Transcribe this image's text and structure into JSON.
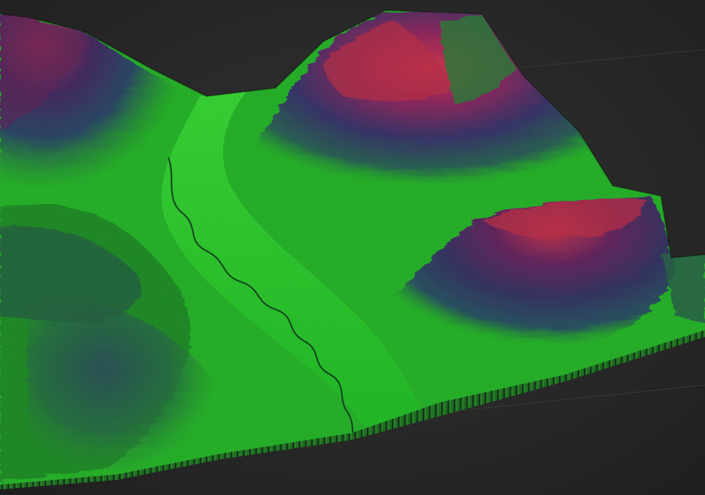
{
  "scene": {
    "type": "3d-terrain-render",
    "elevation_colormap": [
      "#1fdc2a",
      "#2e8a3a",
      "#2f5a6e",
      "#4a2f6a",
      "#8a2d63",
      "#d83a5a"
    ],
    "background_color": "#2b2b2b",
    "features": [
      "river-valley",
      "north-peak",
      "east-peak",
      "west-ridge",
      "terrain-base-skirt"
    ]
  }
}
